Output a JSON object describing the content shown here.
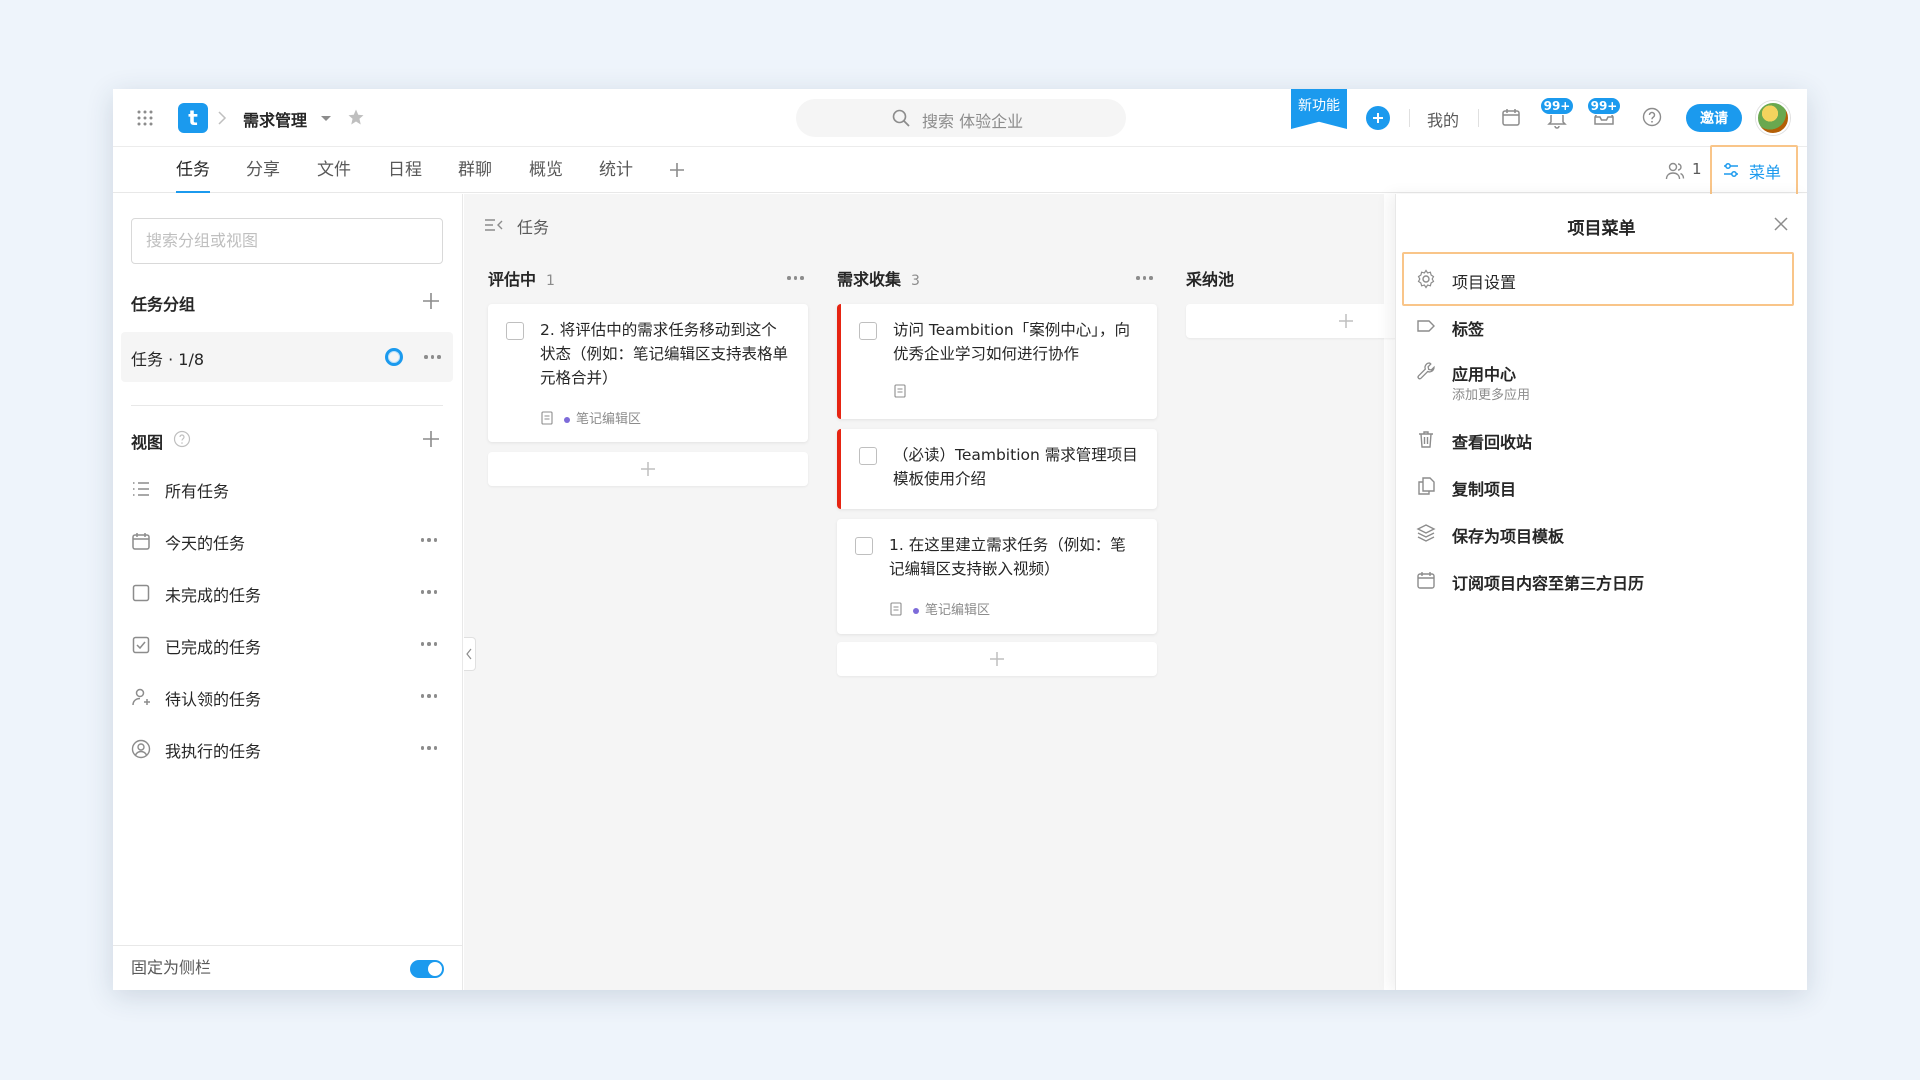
{
  "topbar": {
    "project_name": "需求管理",
    "search_placeholder": "搜索 体验企业",
    "new_feature_label": "新功能",
    "mine_label": "我的",
    "notify_badge": "99+",
    "inbox_badge": "99+",
    "invite_label": "邀请",
    "logo_letter": "t"
  },
  "tabs": {
    "items": [
      {
        "label": "任务",
        "active": true
      },
      {
        "label": "分享"
      },
      {
        "label": "文件"
      },
      {
        "label": "日程"
      },
      {
        "label": "群聊"
      },
      {
        "label": "概览"
      },
      {
        "label": "统计"
      }
    ],
    "member_count": "1",
    "menu_label": "菜单"
  },
  "sidebar": {
    "search_placeholder": "搜索分组或视图",
    "groups_title": "任务分组",
    "group_item": "任务 · 1/8",
    "views_title": "视图",
    "views": [
      {
        "label": "所有任务",
        "icon": "list-icon"
      },
      {
        "label": "今天的任务",
        "icon": "calendar-icon"
      },
      {
        "label": "未完成的任务",
        "icon": "checkbox-icon"
      },
      {
        "label": "已完成的任务",
        "icon": "checked-box-icon"
      },
      {
        "label": "待认领的任务",
        "icon": "user-icon"
      },
      {
        "label": "我执行的任务",
        "icon": "user-circle-icon"
      }
    ],
    "pin_label": "固定为侧栏",
    "pin_enabled": true
  },
  "board": {
    "breadcrumb": "任务",
    "columns": [
      {
        "title": "评估中",
        "count": "1",
        "cards": [
          {
            "text": "2. 将评估中的需求任务移动到这个状态（例如：笔记编辑区支持表格单元格合并）",
            "tag": "笔记编辑区"
          }
        ]
      },
      {
        "title": "需求收集",
        "count": "3",
        "cards": [
          {
            "text": "访问 Teambition「案例中心」，向优秀企业学习如何进行协作"
          },
          {
            "text": "（必读）Teambition 需求管理项目模板使用介绍"
          },
          {
            "text": "1. 在这里建立需求任务（例如：笔记编辑区支持嵌入视频）",
            "tag": "笔记编辑区"
          }
        ]
      },
      {
        "title": "采纳池",
        "count": "",
        "cards": []
      }
    ]
  },
  "panel": {
    "title": "项目菜单",
    "items": [
      {
        "label": "项目设置",
        "icon": "gear-icon"
      },
      {
        "label": "标签",
        "icon": "tag-icon"
      },
      {
        "label": "应用中心",
        "sub": "添加更多应用",
        "icon": "wrench-icon"
      },
      {
        "label": "查看回收站",
        "icon": "trash-icon"
      },
      {
        "label": "复制项目",
        "icon": "copy-icon"
      },
      {
        "label": "保存为项目模板",
        "icon": "layers-icon"
      },
      {
        "label": "订阅项目内容至第三方日历",
        "icon": "calendar-icon"
      }
    ]
  },
  "colors": {
    "accent": "#1b9aee",
    "highlight": "#f9c589",
    "danger": "#e62412"
  }
}
